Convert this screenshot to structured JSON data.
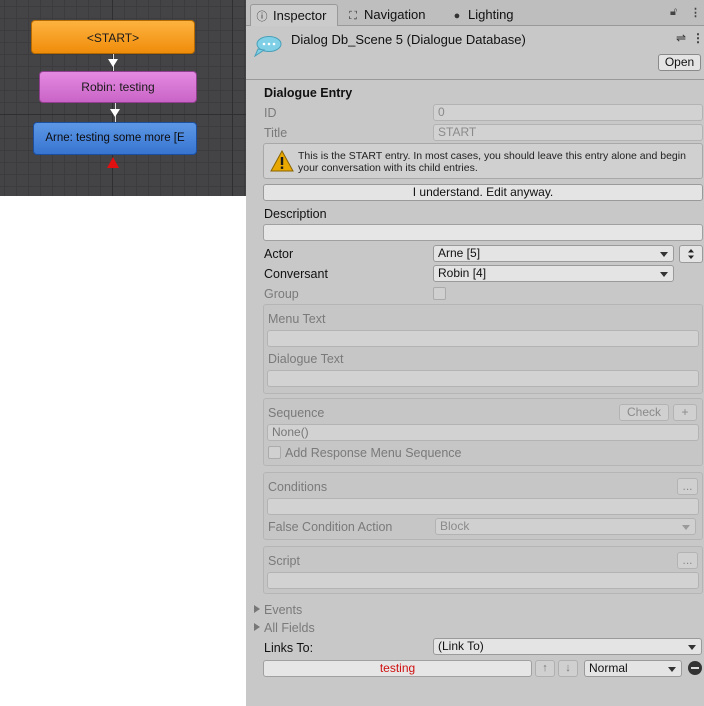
{
  "graph": {
    "nodes": [
      {
        "label": "<START>",
        "color": "#f7a020"
      },
      {
        "label": "Robin: testing",
        "color": "#d878d5"
      },
      {
        "label": "Arne: testing some more [E",
        "color": "#4a86dc"
      }
    ]
  },
  "tabs": [
    {
      "label": "Inspector",
      "icon": "info-icon"
    },
    {
      "label": "Navigation",
      "icon": "navigation-icon"
    },
    {
      "label": "Lighting",
      "icon": "lightbulb-icon"
    }
  ],
  "header": {
    "title": "Dialog Db_Scene 5 (Dialogue Database)",
    "open_label": "Open"
  },
  "entry": {
    "section_title": "Dialogue Entry",
    "id_label": "ID",
    "id_value": "0",
    "title_label": "Title",
    "title_value": "START",
    "warning_text": "This is the START entry. In most cases, you should leave this entry alone and begin your conversation with its child entries.",
    "understand_label": "I understand. Edit anyway.",
    "description_label": "Description",
    "description_value": "",
    "actor_label": "Actor",
    "actor_value": "Arne [5]",
    "conversant_label": "Conversant",
    "conversant_value": "Robin [4]",
    "group_label": "Group",
    "menu_text_label": "Menu Text",
    "dialogue_text_label": "Dialogue Text",
    "sequence_label": "Sequence",
    "check_label": "Check",
    "plus_label": "+",
    "sequence_value": "None()",
    "add_response_label": "Add Response Menu Sequence",
    "conditions_label": "Conditions",
    "ellipsis_label": "...",
    "false_condition_label": "False Condition Action",
    "false_condition_value": "Block",
    "script_label": "Script",
    "events_label": "Events",
    "all_fields_label": "All Fields",
    "links_to_label": "Links To:",
    "links_to_value": "(Link To)",
    "link_entry": "testing",
    "link_priority": "Normal",
    "up_label": "↑",
    "down_label": "↓"
  },
  "colors": {
    "warning": "#e8a800",
    "link_text": "#d01010",
    "start_marker": "#e01010"
  }
}
